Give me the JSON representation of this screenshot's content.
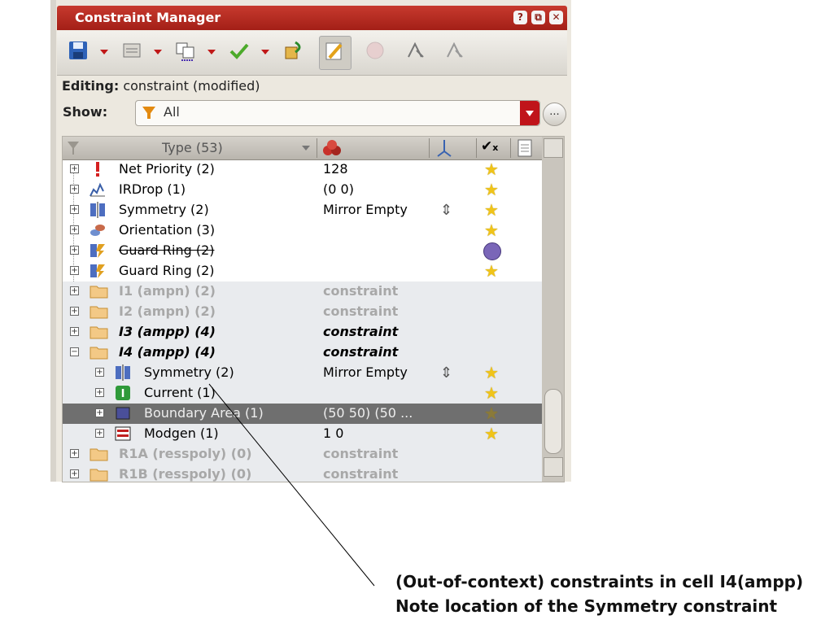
{
  "window": {
    "title": "Constraint Manager",
    "title_buttons": [
      "?",
      "⧉",
      "✕"
    ]
  },
  "toolbar": {
    "icons": [
      "save-icon",
      "list-icon",
      "copy-icon",
      "check-icon",
      "undo-icon",
      "edit-icon",
      "disabled-icon",
      "route-icon",
      "route2-icon"
    ]
  },
  "editing": {
    "label": "Editing:",
    "value": "constraint (modified)"
  },
  "show": {
    "label": "Show:",
    "value": "All",
    "more": "..."
  },
  "table": {
    "header": {
      "type": "Type (53)"
    },
    "rows": [
      {
        "label": "Net Priority (2)",
        "value": "128",
        "icon": "net-priority-icon",
        "star": true
      },
      {
        "label": "IRDrop (1)",
        "value": "(0 0)",
        "icon": "irdrop-icon",
        "star": true
      },
      {
        "label": "Symmetry (2)",
        "value": "Mirror Empty",
        "icon": "symmetry-icon",
        "star": true,
        "arrow": true
      },
      {
        "label": "Orientation (3)",
        "value": "",
        "icon": "orientation-icon",
        "star": true
      },
      {
        "label": "Guard Ring (2)",
        "value": "",
        "icon": "guard-ring-icon",
        "disabled": true,
        "strike": true
      },
      {
        "label": "Guard Ring (2)",
        "value": "",
        "icon": "guard-ring-icon",
        "star": true
      },
      {
        "label": "I1 (ampn) (2)",
        "value": "constraint",
        "icon": "folder-icon",
        "style": "grey"
      },
      {
        "label": "I2 (ampn) (2)",
        "value": "constraint",
        "icon": "folder-icon",
        "style": "grey"
      },
      {
        "label": "I3 (ampp) (4)",
        "value": "constraint",
        "icon": "folder-icon",
        "style": "bold-italic"
      },
      {
        "label": "I4 (ampp) (4)",
        "value": "constraint",
        "icon": "folder-icon",
        "style": "bold-italic",
        "expanded": true
      },
      {
        "label": "Symmetry (2)",
        "value": "Mirror Empty",
        "icon": "symmetry-icon",
        "star": true,
        "arrow": true,
        "child": true
      },
      {
        "label": "Current (1)",
        "value": "",
        "icon": "current-icon",
        "star": true,
        "child": true
      },
      {
        "label": "Boundary Area (1)",
        "value": "(50 50) (50 ...",
        "icon": "boundary-area-icon",
        "star": true,
        "child": true,
        "selected": true
      },
      {
        "label": "Modgen (1)",
        "value": "1 0",
        "icon": "modgen-icon",
        "star": true,
        "child": true
      },
      {
        "label": "R1A (resspoly) (0)",
        "value": "constraint",
        "icon": "folder-icon",
        "style": "grey"
      },
      {
        "label": "R1B (resspoly) (0)",
        "value": "constraint",
        "icon": "folder-icon",
        "style": "grey"
      }
    ]
  },
  "annotation": {
    "line1": "(Out-of-context) constraints in cell I4(ampp)",
    "line2": "Note location of the Symmetry constraint"
  },
  "colors": {
    "title_bar": "#b52a20",
    "selected_row": "#6f6f6f",
    "star": "#f0c419"
  }
}
